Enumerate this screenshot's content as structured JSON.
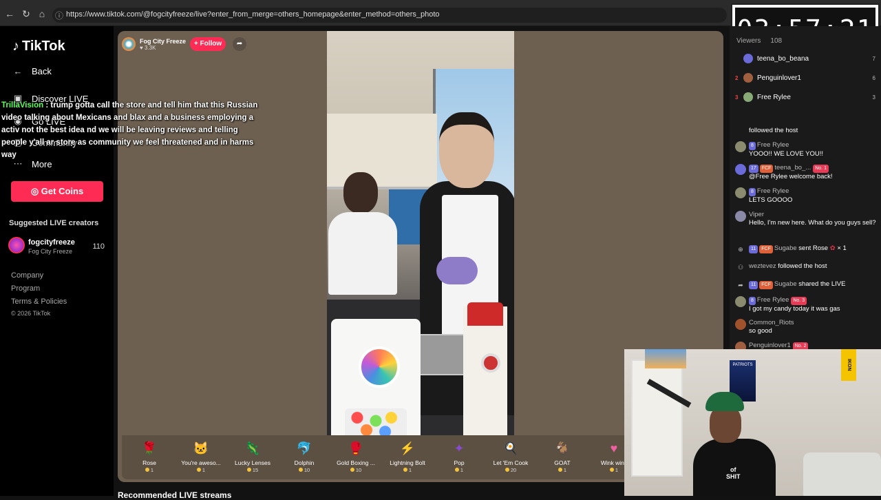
{
  "browser": {
    "url": "https://www.tiktok.com/@fogcityfreeze/live?enter_from_merge=others_homepage&enter_method=others_photo"
  },
  "timer": {
    "text": "03:57:21"
  },
  "sidebar": {
    "logo": "TikTok",
    "back": "Back",
    "discover_live": "Discover LIVE",
    "go_live": "Go LIVE",
    "community": "Community",
    "more": "More",
    "get_coins": "Get Coins",
    "suggested_title": "Suggested LIVE creators",
    "creator": {
      "handle": "fogcityfreeze",
      "name": "Fog City Freeze",
      "count": "110"
    },
    "footer": {
      "company": "Company",
      "program": "Program",
      "terms": "Terms & Policies",
      "copyright": "© 2026 TikTok"
    }
  },
  "overlay_chat": {
    "user": "TrillaVision",
    "separator": " : ",
    "text": "trump gotta call the store and tell him that this Russian video talking about Mexicans and blax and a business employing a activ not the best idea nd we will be leaving reviews and telling people y'all ar store as community we feel threatened and in harms way"
  },
  "host": {
    "name": "Fog City Freeze",
    "likes": "3.3K",
    "follow_label": "+ Follow"
  },
  "gifts": [
    {
      "name": "Rose",
      "price": "1",
      "icon": "rose-icon",
      "glyph": "🌹",
      "color": "#d8334a"
    },
    {
      "name": "You're aweso...",
      "price": "1",
      "icon": "cat-icon",
      "glyph": "🐱",
      "color": "#c9a27a"
    },
    {
      "name": "Lucky Lenses",
      "price": "15",
      "icon": "lizard-icon",
      "glyph": "🦎",
      "color": "#5aa84a"
    },
    {
      "name": "Dolphin",
      "price": "10",
      "icon": "dolphin-icon",
      "glyph": "🐬",
      "color": "#3a8ad2"
    },
    {
      "name": "Gold Boxing ...",
      "price": "10",
      "icon": "boxing-glove-icon",
      "glyph": "🥊",
      "color": "#e4b43a"
    },
    {
      "name": "Lightning Bolt",
      "price": "1",
      "icon": "lightning-icon",
      "glyph": "⚡",
      "color": "#f0d020"
    },
    {
      "name": "Pop",
      "price": "1",
      "icon": "pop-icon",
      "glyph": "✦",
      "color": "#8a4ad2"
    },
    {
      "name": "Let 'Em Cook",
      "price": "20",
      "icon": "cook-icon",
      "glyph": "🍳",
      "color": "#6a6a8a"
    },
    {
      "name": "GOAT",
      "price": "1",
      "icon": "goat-icon",
      "glyph": "🐐",
      "color": "#d84a3a"
    },
    {
      "name": "Wink wink",
      "price": "1",
      "icon": "heart-icon",
      "glyph": "♥",
      "color": "#f060a0"
    }
  ],
  "recommended": "Recommended LIVE streams",
  "chat": {
    "viewers_label": "Viewers",
    "viewers_count": "108",
    "viewers": [
      {
        "rank": "",
        "name": "teena_bo_beana",
        "count": "7"
      },
      {
        "rank": "2",
        "name": "Penguinlover1",
        "count": "6"
      },
      {
        "rank": "3",
        "name": "Free Rylee",
        "count": "3"
      }
    ],
    "messages": {
      "m0": {
        "text": "followed the host"
      },
      "m1": {
        "level": "8",
        "name": "Free Rylee",
        "text": "YOOO!! WE LOVE YOU!!"
      },
      "m2": {
        "level": "17",
        "fcf": "FCF",
        "name": "teena_bo_...",
        "badge": "No. 1",
        "text": "@Free Rylee welcome back!"
      },
      "m3": {
        "level": "8",
        "name": "Free Rylee",
        "text": "LETS GOOOO"
      },
      "m4": {
        "name": "Viper",
        "text": "Hello, I'm new here. What do you guys sell?"
      },
      "m5": {
        "level": "11",
        "fcf": "FCF",
        "name": "Sugabe",
        "text": "sent Rose",
        "multiplier": "× 1"
      },
      "m6": {
        "name": "weztevez",
        "text": "followed the host"
      },
      "m7": {
        "level": "11",
        "fcf": "FCF",
        "name": "Sugabe",
        "text": "shared the LIVE"
      },
      "m8": {
        "level": "8",
        "name": "Free Rylee",
        "badge": "No. 3",
        "text": "I got my candy today it was gas"
      },
      "m9": {
        "name": "Common_Riots",
        "text": "so good"
      },
      "m10": {
        "name": "Penguinlover1",
        "badge": "No. 2"
      }
    }
  },
  "webcam": {
    "poster_text": "PATRIOTS",
    "banner_text": "IKON",
    "hoodie_text_1": "of",
    "hoodie_text_2": "SHIT"
  }
}
